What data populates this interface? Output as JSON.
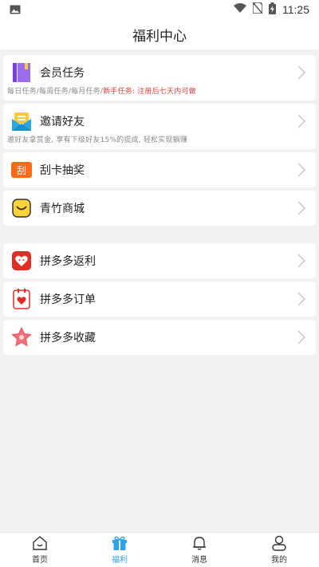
{
  "status_bar": {
    "time": "11:25"
  },
  "header": {
    "title": "福利中心"
  },
  "group1": {
    "items": [
      {
        "label": "会员任务",
        "sub_parts": [
          "每日任务/每周任务/每月任务/",
          "新手任务: 注册后七天内可做"
        ]
      },
      {
        "label": "邀请好友",
        "sub": "邀好友拿赏金, 享有下级好友15%的提成, 轻松实现躺赚"
      },
      {
        "label": "刮卡抽奖",
        "icon_text": "刮"
      },
      {
        "label": "青竹商城"
      }
    ]
  },
  "group2": {
    "items": [
      {
        "label": "拼多多返利"
      },
      {
        "label": "拼多多订单"
      },
      {
        "label": "拼多多收藏"
      }
    ]
  },
  "bottom_nav": {
    "items": [
      {
        "label": "首页"
      },
      {
        "label": "福利"
      },
      {
        "label": "消息"
      },
      {
        "label": "我的"
      }
    ],
    "active_color": "#2ea1ef"
  }
}
